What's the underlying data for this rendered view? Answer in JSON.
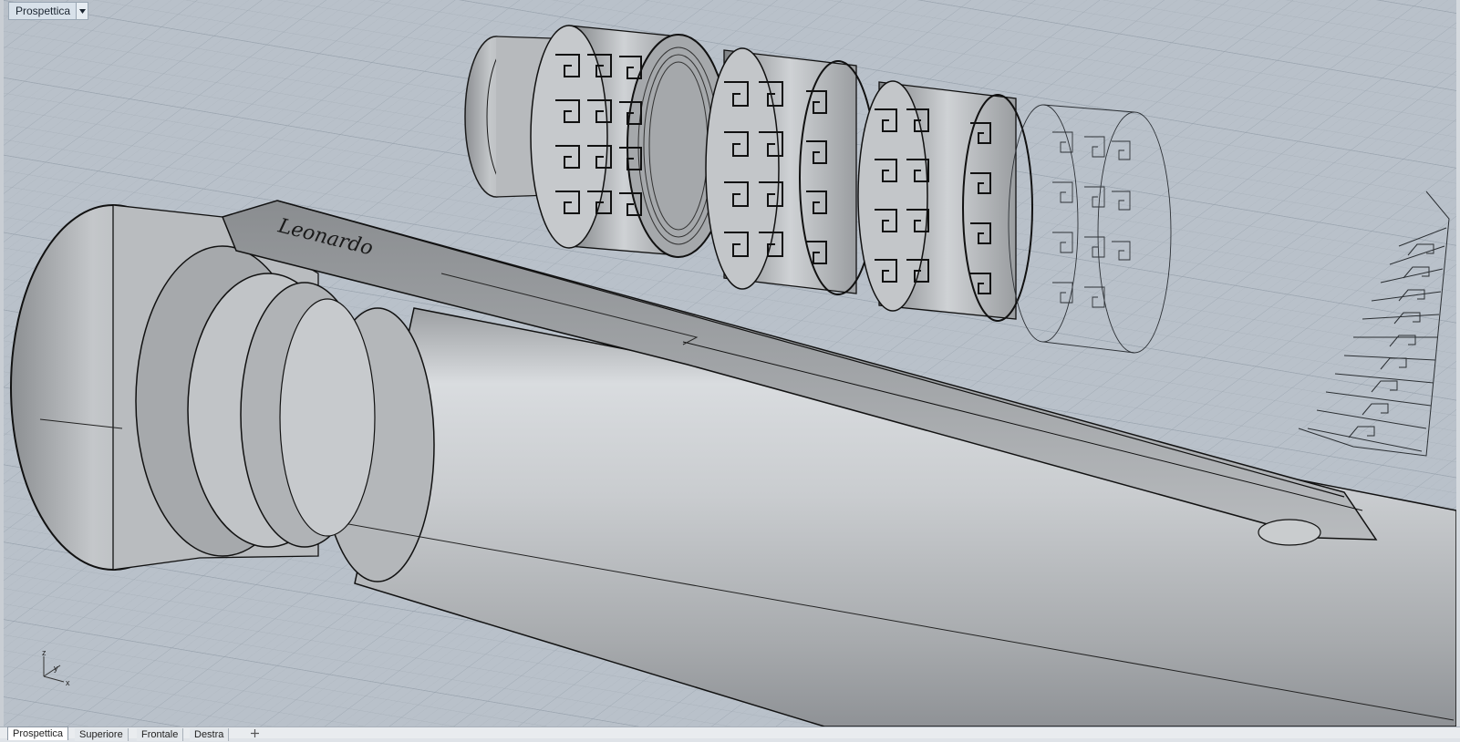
{
  "viewport": {
    "title": "Prospettica",
    "menu_icon": "triangle-down-icon",
    "background": "#b7bfc8",
    "grid_color": "#a4adb7",
    "axis_labels": {
      "z": "z",
      "y": "y",
      "x": "x"
    }
  },
  "tabs": [
    {
      "label": "Prospettica",
      "active": true
    },
    {
      "label": "Superiore",
      "active": false
    },
    {
      "label": "Frontale",
      "active": false
    },
    {
      "label": "Destra",
      "active": false
    }
  ],
  "add_tab_icon": "plus-icon",
  "model": {
    "engraving": "Leonardo",
    "object_color": "#bfc3c7",
    "edge_color": "#1a1a1a"
  }
}
